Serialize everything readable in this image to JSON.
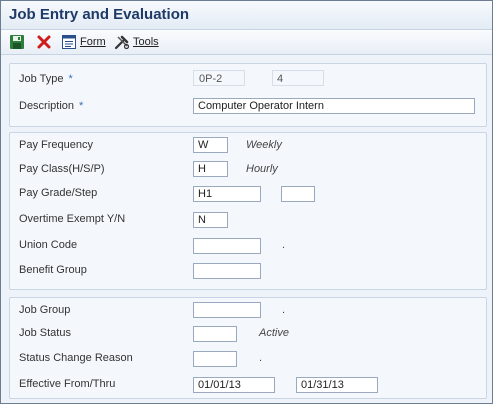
{
  "window": {
    "title": "Job Entry and Evaluation"
  },
  "toolbar": {
    "form_label": "Form",
    "form_key": "F",
    "tools_label": "Tools",
    "tools_key": "T"
  },
  "job": {
    "job_type_label": "Job Type",
    "job_type_value": "0P-2",
    "job_step_value": "4",
    "description_label": "Description",
    "description_value": "Computer Operator Intern",
    "required_marker": "*"
  },
  "pay": {
    "frequency_label": "Pay Frequency",
    "frequency_value": "W",
    "frequency_desc": "Weekly",
    "class_label": "Pay Class(H/S/P)",
    "class_value": "H",
    "class_desc": "Hourly",
    "grade_label": "Pay Grade/Step",
    "grade_value": "H1",
    "step_value": "",
    "overtime_label": "Overtime Exempt Y/N",
    "overtime_value": "N",
    "union_label": "Union Code",
    "union_value": "",
    "union_desc": ".",
    "benefit_label": "Benefit Group",
    "benefit_value": ""
  },
  "status": {
    "group_label": "Job Group",
    "group_value": "",
    "group_desc": ".",
    "status_label": "Job Status",
    "status_value": "",
    "status_desc": "Active",
    "reason_label": "Status Change Reason",
    "reason_value": "",
    "reason_desc": ".",
    "effective_label": "Effective From/Thru",
    "from_value": "01/01/13",
    "thru_value": "01/31/13"
  },
  "colors": {
    "title_text": "#1f3a66",
    "required_star": "#3b6fb6",
    "panel_bg": "#f4f8fc",
    "cancel_red": "#d11a1a",
    "save_green": "#2f7d3a"
  }
}
